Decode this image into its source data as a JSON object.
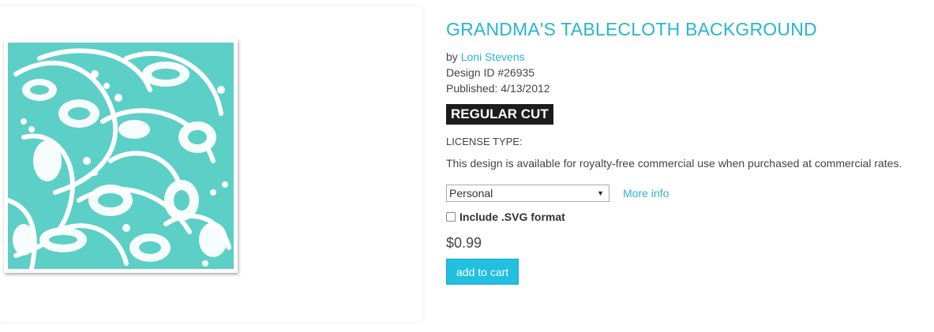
{
  "product": {
    "title": "GRANDMA'S TABLECLOTH BACKGROUND",
    "by_prefix": "by",
    "author": "Loni Stevens",
    "design_id": "Design ID #26935",
    "published": "Published: 4/13/2012",
    "badge": "REGULAR CUT"
  },
  "license": {
    "type_label": "LICENSE TYPE:",
    "description": "This design is available for royalty-free commercial use when purchased at commercial rates.",
    "selected": "Personal",
    "more_info": "More info"
  },
  "options": {
    "svg_label": "Include .SVG format"
  },
  "purchase": {
    "price": "$0.99",
    "add_to_cart": "add to cart"
  },
  "colors": {
    "accent": "#27b5cf",
    "lace_background": "#5ccfc7",
    "button": "#22bfe0"
  }
}
